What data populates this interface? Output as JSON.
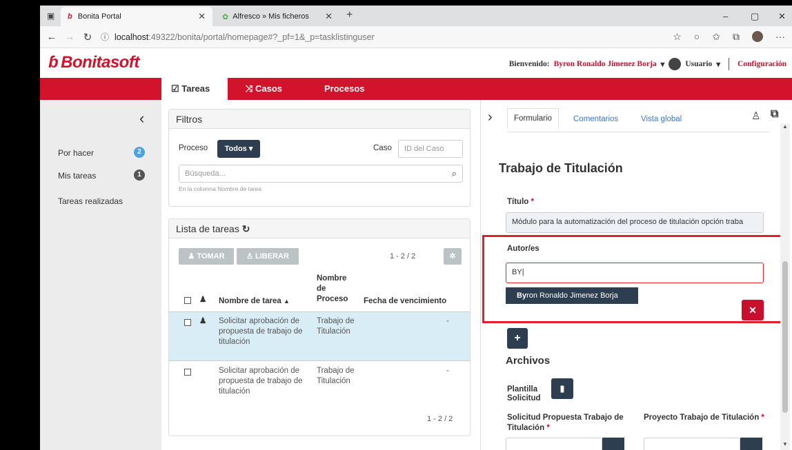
{
  "browser": {
    "tabs": [
      {
        "title": "Bonita Portal",
        "active": true
      },
      {
        "title": "Alfresco » Mis ficheros",
        "active": false
      }
    ],
    "new_tab": "+",
    "url_host": "localhost",
    "url_rest": ":49322/bonita/portal/homepage#?_pf=1&_p=tasklistinguser",
    "window_controls": [
      "–",
      "▢",
      "✕"
    ]
  },
  "header": {
    "logo": "Bonitasoft",
    "welcome_label": "Bienvenido:",
    "user_name": "Byron Ronaldo Jimenez Borja",
    "profile": "Usuario",
    "config": "Configuración"
  },
  "nav": {
    "tabs": [
      "Tareas",
      "Casos",
      "Procesos"
    ],
    "selected": "Tareas"
  },
  "sidebar": {
    "items": [
      {
        "label": "Por hacer",
        "count": "2",
        "badge_color": "#4aa3df"
      },
      {
        "label": "Mis tareas",
        "count": "1",
        "badge_color": "#555555"
      },
      {
        "label": "Tareas realizadas"
      }
    ]
  },
  "filters": {
    "title": "Filtros",
    "proceso_label": "Proceso",
    "proceso_value": "Todos ▾",
    "caso_label": "Caso",
    "caso_placeholder": "ID del Caso",
    "search_placeholder": "Búsqueda...",
    "search_hint": "En la columna Nombre de tarea"
  },
  "tasklist": {
    "title": "Lista de tareas",
    "take": "TOMAR",
    "release": "LIBERAR",
    "pager": "1 - 2 / 2",
    "columns": {
      "name": "Nombre de tarea",
      "process": "Nombre de Proceso",
      "due": "Fecha de vencimiento"
    },
    "rows": [
      {
        "name": "Solicitar aprobación de propuesta de trabajo de titulación",
        "process": "Trabajo de Titulación",
        "due": "-",
        "assigned": true,
        "selected": true
      },
      {
        "name": "Solicitar aprobación de propuesta de trabajo de titulación",
        "process": "Trabajo de Titulación",
        "due": "-",
        "assigned": false,
        "selected": false
      }
    ],
    "pager_bottom": "1 - 2 / 2"
  },
  "form": {
    "tabs": [
      "Formulario",
      "Comentarios",
      "Vista global"
    ],
    "title": "Trabajo de Titulación",
    "titulo_label": "Título",
    "titulo_value": "Módulo para la automatización del proceso de titulación opción traba",
    "autores_label": "Autor/es",
    "autores_value": "BY",
    "suggestion_bold": "By",
    "suggestion_rest": "ron Ronaldo Jimenez Borja",
    "archivos": "Archivos",
    "plantilla_label": "Plantilla Solicitud",
    "solicitud_label": "Solicitud Propuesta Trabajo de Titulación",
    "proyecto_label": "Proyecto Trabajo de Titulación",
    "required": "*"
  },
  "colors": {
    "brand_red": "#d3122b",
    "dark_button": "#2c3e50",
    "highlight_box": "#e0202e",
    "selected_row": "#d9edf7"
  }
}
